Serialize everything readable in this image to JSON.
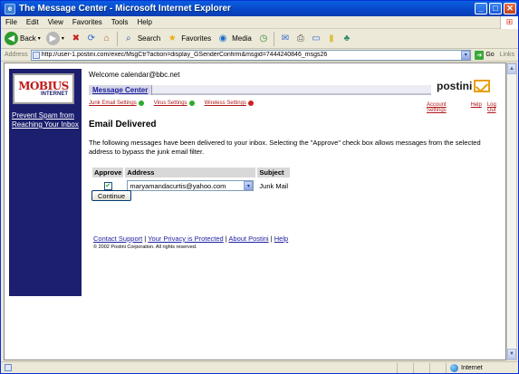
{
  "window": {
    "title": "The Message Center - Microsoft Internet Explorer",
    "minimize": "_",
    "maximize": "□",
    "close": "✕"
  },
  "menu": [
    "File",
    "Edit",
    "View",
    "Favorites",
    "Tools",
    "Help"
  ],
  "toolbar": {
    "back": "Back",
    "search": "Search",
    "favorites": "Favorites",
    "media": "Media"
  },
  "address": {
    "label": "Address",
    "url": "http://user-1.postini.com/exec/MsgCtr?action=display_GSenderConfirm&msgid=7444240846_msgs26",
    "go": "Go",
    "links": "Links"
  },
  "sidebar": {
    "logo_main": "MOBIUS",
    "logo_sub": "INTERNET",
    "link": "Prevent Spam from Reaching Your Inbox"
  },
  "page": {
    "welcome": "Welcome calendar@bbc.net",
    "brand": "postini",
    "tab": "Message Center",
    "sublinks": [
      {
        "label": "Junk Email Settings",
        "status_color": "#2eaa2e"
      },
      {
        "label": "Virus Settings",
        "status_color": "#2eaa2e"
      },
      {
        "label": "Wireless Settings",
        "status_color": "#d02020"
      }
    ],
    "right_links": [
      "Account Settings",
      "Help",
      "Log Out"
    ],
    "heading": "Email Delivered",
    "description": "The following messages have been delivered to your inbox. Selecting the \"Approve\" check box allows messages from the selected address to bypass the junk email filter.",
    "table": {
      "headers": [
        "Approve",
        "Address",
        "Subject"
      ],
      "rows": [
        {
          "approved": true,
          "address": "maryamandacurtis@yahoo.com",
          "subject": "Junk Mail"
        }
      ]
    },
    "continue_button": "Continue",
    "footer_links": [
      "Contact Support",
      "Your Privacy is Protected",
      "About Postini",
      "Help"
    ],
    "copyright": "© 2002 Postini Corporation. All rights reserved."
  },
  "status": {
    "zone": "Internet"
  }
}
